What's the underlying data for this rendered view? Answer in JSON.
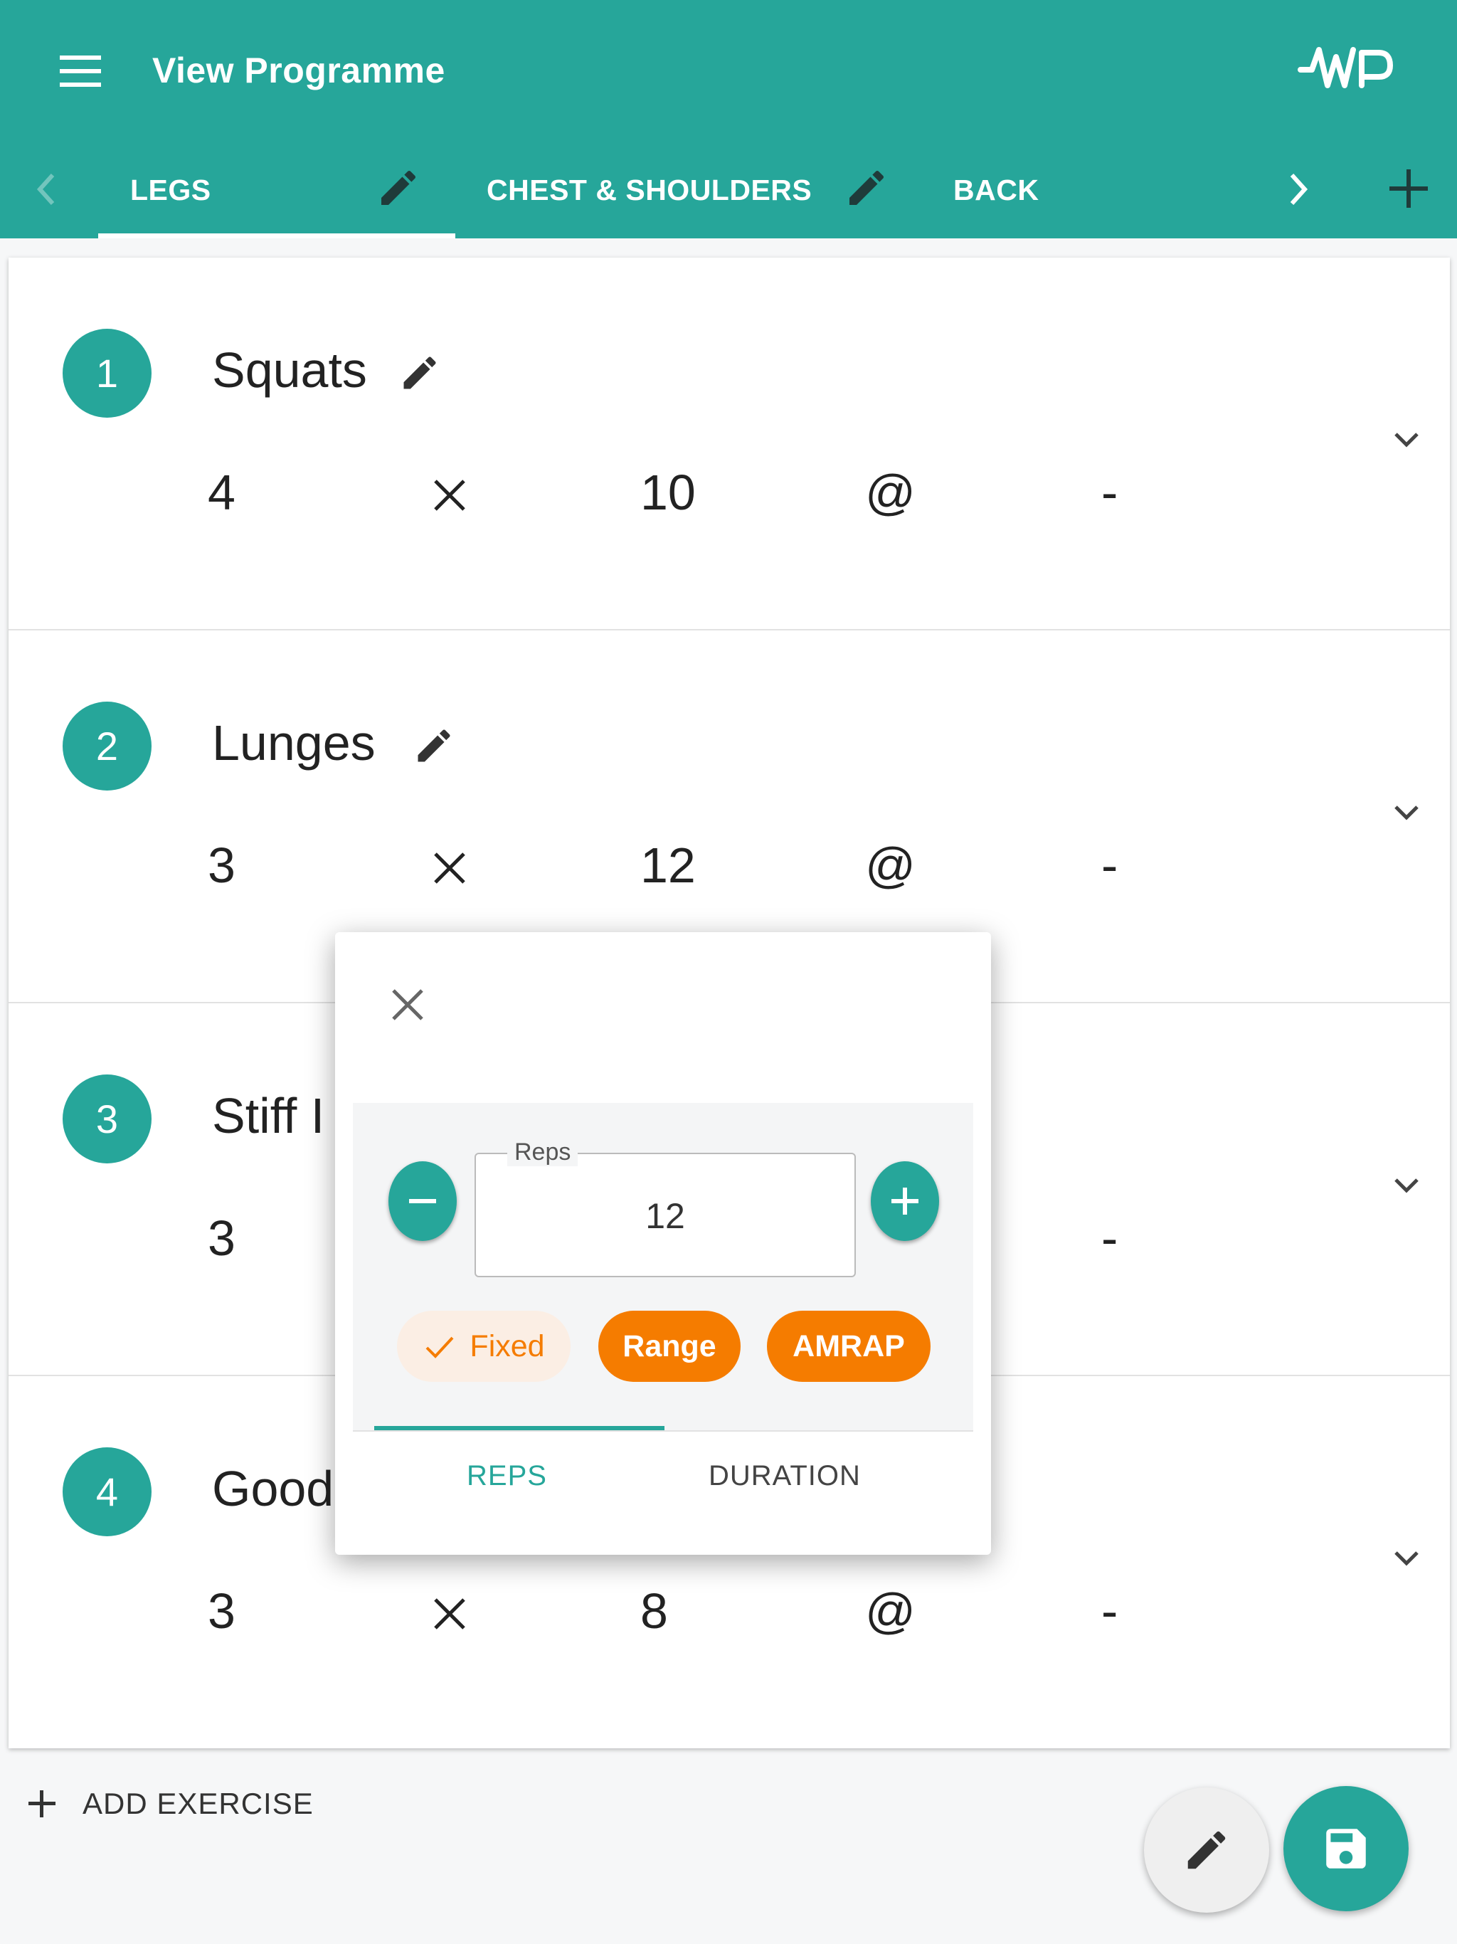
{
  "appbar": {
    "title": "View Programme"
  },
  "tabs": [
    {
      "label": "LEGS"
    },
    {
      "label": "CHEST & SHOULDERS"
    },
    {
      "label": "BACK"
    }
  ],
  "exercises": [
    {
      "index": "1",
      "name": "Squats",
      "sets": "4",
      "reps": "10",
      "at": "@",
      "weight": "-"
    },
    {
      "index": "2",
      "name": "Lunges",
      "sets": "3",
      "reps": "12",
      "at": "@",
      "weight": "-"
    },
    {
      "index": "3",
      "name": "Stiff I",
      "sets": "3",
      "reps": "",
      "at": "",
      "weight": "-"
    },
    {
      "index": "4",
      "name": "Good",
      "sets": "3",
      "reps": "8",
      "at": "@",
      "weight": "-"
    }
  ],
  "add_exercise_label": "ADD EXERCISE",
  "dialog": {
    "field_label": "Reps",
    "field_value": "12",
    "chips": {
      "fixed": "Fixed",
      "range": "Range",
      "amrap": "AMRAP"
    },
    "tabs": {
      "reps": "REPS",
      "duration": "DURATION"
    }
  },
  "colors": {
    "primary": "#26a69a",
    "accent": "#f57c00",
    "accent_light": "#fbeee4"
  }
}
